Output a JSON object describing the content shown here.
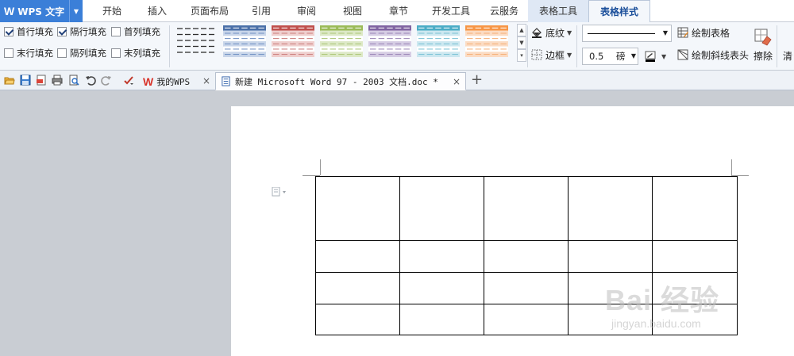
{
  "app": {
    "logo": "W",
    "name": "WPS 文字"
  },
  "menu": {
    "items": [
      "开始",
      "插入",
      "页面布局",
      "引用",
      "审阅",
      "视图",
      "章节",
      "开发工具",
      "云服务"
    ],
    "context_tabs": [
      "表格工具",
      "表格样式"
    ],
    "active_tab": "表格样式"
  },
  "ribbon": {
    "options": [
      "首行填充",
      "隔行填充",
      "首列填充",
      "末行填充",
      "隔列填充",
      "末列填充"
    ],
    "options_checked": [
      true,
      true,
      false,
      false,
      false,
      false
    ],
    "table_styles": [
      {
        "header": "#2f2f2f",
        "band": "#ffffff",
        "line": "#2f2f2f"
      },
      {
        "header": "#4a6fa8",
        "band": "#c9d6ea",
        "line": "#6b8cc0"
      },
      {
        "header": "#c0504d",
        "band": "#efcfce",
        "line": "#c97a78"
      },
      {
        "header": "#9bbb59",
        "band": "#dde9c7",
        "line": "#a9c473"
      },
      {
        "header": "#8064a2",
        "band": "#d6cde4",
        "line": "#9782b4"
      },
      {
        "header": "#4bacc6",
        "band": "#cde8f0",
        "line": "#76bfd3"
      },
      {
        "header": "#f79646",
        "band": "#fbdcc4",
        "line": "#f5ad74"
      }
    ],
    "shading_label": "底纹",
    "border_label": "边框",
    "line_width_value": "0.5",
    "line_width_unit": "磅",
    "draw_table_label": "绘制表格",
    "draw_diagonal_label": "绘制斜线表头",
    "erase_label": "擦除",
    "clear_label": "清"
  },
  "tabs": {
    "inactive": {
      "label": "我的WPS"
    },
    "active": {
      "label": "新建 Microsoft Word 97 - 2003 文档.doc *"
    },
    "close_symbol": "×",
    "new_tab_symbol": "+"
  },
  "document": {
    "table": {
      "rows": 4,
      "cols": 5,
      "row_heights": [
        81,
        40,
        40,
        39
      ],
      "col_widths": [
        106,
        106,
        106,
        106,
        107
      ]
    }
  },
  "watermark": {
    "main": "Bai 经验",
    "sub": "jingyan.baidu.com"
  },
  "colors": {
    "app_blue": "#3b7fd8",
    "ribbon_bg": "#f4f7fb",
    "context_tab": "#dfe8f5",
    "workspace": "#c9cdd3"
  }
}
